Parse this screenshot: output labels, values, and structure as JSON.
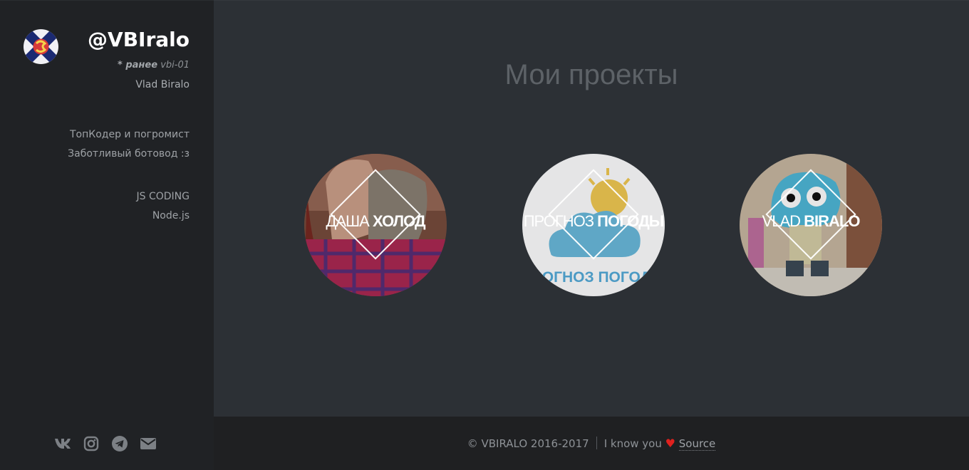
{
  "profile": {
    "handle": "@VBIralo",
    "prev_prefix": "* ранее",
    "prev_name": "vbi-01",
    "real_name": "Vlad Biralo",
    "bio": [
      "ТопКодер и погромист",
      "Заботливый ботовод :з"
    ],
    "skills": [
      "JS CODING",
      "Node.js"
    ]
  },
  "social": [
    {
      "name": "vk-icon"
    },
    {
      "name": "instagram-icon"
    },
    {
      "name": "telegram-icon"
    },
    {
      "name": "mail-icon"
    }
  ],
  "main": {
    "title": "Мои проекты",
    "projects": [
      {
        "word1": "ДАША",
        "word2": "ХОЛОД"
      },
      {
        "word1": "ПРОГНОЗ",
        "word2": "ПОГОДЫ",
        "caption": "ПРОГНОЗ ПОГОДЫ"
      },
      {
        "word1": "VLAD",
        "word2": "BIRALO"
      }
    ]
  },
  "footer": {
    "copyright": "© VBIRALO 2016-2017",
    "love_text": "I know you",
    "heart": "♥",
    "source": "Source"
  },
  "colors": {
    "sidebar_bg": "#202225",
    "main_bg": "#2c3035",
    "footer_bg": "#1f2022",
    "heart": "#e0211e"
  }
}
